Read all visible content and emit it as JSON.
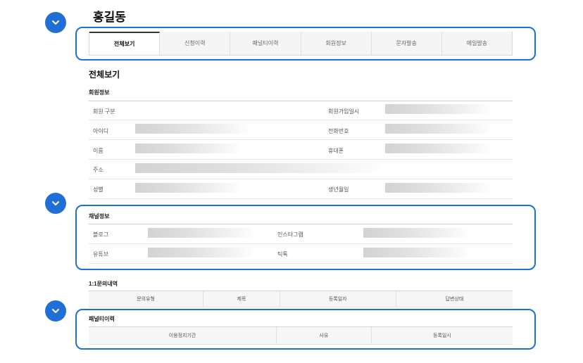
{
  "page": {
    "name": "홍길동"
  },
  "tabs": [
    {
      "label": "전체보기",
      "active": true
    },
    {
      "label": "신청이력",
      "active": false
    },
    {
      "label": "패널티이력",
      "active": false
    },
    {
      "label": "회원정보",
      "active": false
    },
    {
      "label": "문자발송",
      "active": false
    },
    {
      "label": "메일발송",
      "active": false
    }
  ],
  "section_title": "전체보기",
  "member_info": {
    "title": "회원정보",
    "left_labels": [
      "회원 구분",
      "아이디",
      "이름",
      "주소",
      "성별"
    ],
    "right_labels": [
      "회원가입일시",
      "전화번호",
      "휴대폰",
      "생년월일"
    ]
  },
  "channel_info": {
    "title": "채널정보",
    "left_labels": [
      "블로그",
      "유튜브"
    ],
    "right_labels": [
      "인스타그램",
      "틱톡"
    ]
  },
  "inquiry": {
    "title": "1:1문의내역",
    "columns": [
      "문의유형",
      "제목",
      "등록일자",
      "답변상태"
    ]
  },
  "penalty": {
    "title": "패널티이력",
    "columns": [
      "이용정지기간",
      "사유",
      "등록일시"
    ]
  },
  "colors": {
    "accent": "#1f6fd6"
  },
  "icons": {
    "marker": "chevron-down-icon"
  }
}
